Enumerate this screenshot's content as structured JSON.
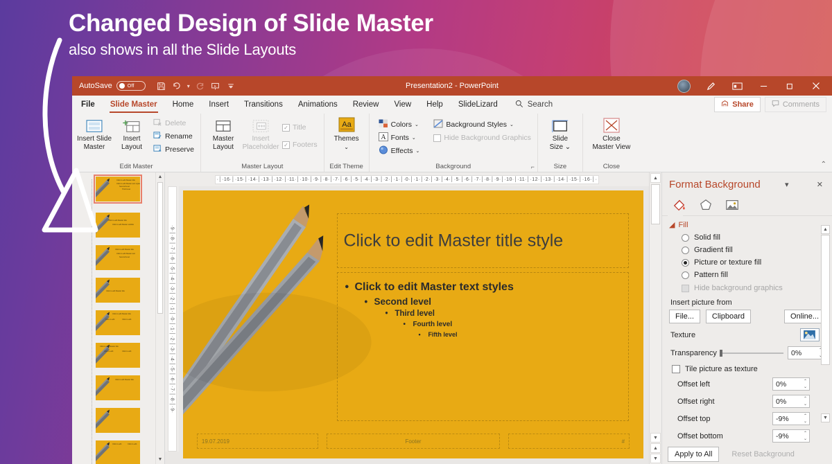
{
  "headline": {
    "title": "Changed Design of Slide Master",
    "subtitle": "also shows in all the Slide Layouts"
  },
  "colors": {
    "accent": "#b7472a",
    "slide_bg": "#e8aa14",
    "bg_gradient_start": "#5b3b9e",
    "bg_gradient_end": "#d04e45"
  },
  "titlebar": {
    "autosave_label": "AutoSave",
    "autosave_state": "Off",
    "document_title": "Presentation2  -  PowerPoint",
    "icons": [
      "save-icon",
      "undo-icon",
      "undo-caret-icon",
      "redo-icon",
      "present-icon",
      "customize-qat-icon"
    ],
    "window_buttons": [
      "minimize",
      "restore",
      "close"
    ]
  },
  "tabs": {
    "items": [
      {
        "label": "File",
        "active": false
      },
      {
        "label": "Slide Master",
        "active": true
      },
      {
        "label": "Home",
        "active": false
      },
      {
        "label": "Insert",
        "active": false
      },
      {
        "label": "Transitions",
        "active": false
      },
      {
        "label": "Animations",
        "active": false
      },
      {
        "label": "Review",
        "active": false
      },
      {
        "label": "View",
        "active": false
      },
      {
        "label": "Help",
        "active": false
      },
      {
        "label": "SlideLizard",
        "active": false
      }
    ],
    "search_placeholder": "Search",
    "share_label": "Share",
    "comments_label": "Comments"
  },
  "ribbon": {
    "groups": [
      {
        "name": "Edit Master",
        "big": [
          {
            "label_line1": "Insert Slide",
            "label_line2": "Master",
            "enabled": true
          },
          {
            "label_line1": "Insert",
            "label_line2": "Layout",
            "enabled": true
          }
        ],
        "small": [
          {
            "label": "Delete",
            "enabled": false
          },
          {
            "label": "Rename",
            "enabled": true
          },
          {
            "label": "Preserve",
            "enabled": true
          }
        ]
      },
      {
        "name": "Master Layout",
        "big": [
          {
            "label_line1": "Master",
            "label_line2": "Layout",
            "enabled": true
          },
          {
            "label_line1": "Insert",
            "label_line2": "Placeholder",
            "enabled": false
          }
        ],
        "small": [
          {
            "label": "Title",
            "enabled": false,
            "checked": true
          },
          {
            "label": "Footers",
            "enabled": false,
            "checked": true
          }
        ]
      },
      {
        "name": "Edit Theme",
        "big": [
          {
            "label_line1": "Themes",
            "label_line2": "",
            "enabled": true
          }
        ],
        "small": []
      },
      {
        "name": "Background",
        "big": [],
        "small": [
          {
            "label": "Colors",
            "enabled": true
          },
          {
            "label": "Fonts",
            "enabled": true
          },
          {
            "label": "Effects",
            "enabled": true
          },
          {
            "label": "Background Styles",
            "enabled": true
          },
          {
            "label": "Hide Background Graphics",
            "enabled": false
          }
        ]
      },
      {
        "name": "Size",
        "big": [
          {
            "label_line1": "Slide",
            "label_line2": "Size",
            "enabled": true
          }
        ],
        "small": []
      },
      {
        "name": "Close",
        "big": [
          {
            "label_line1": "Close",
            "label_line2": "Master View",
            "enabled": true
          }
        ],
        "small": []
      }
    ]
  },
  "thumbnails": {
    "selected_number": "1",
    "count": 9
  },
  "rulers": {
    "horizontal": "·│·16·│·15·│·14·│·13·│·12·│·11·│·10·│·9·│·8·│·7·│·6·│·5·│·4·│·3·│·2·│·1·│·0·│·1·│·2·│·3·│·4·│·5·│·6·│·7·│·8·│·9·│·10·│·11·│·12·│·13·│·14·│·15·│·16·│·",
    "vertical": "·9·│·8·│·7·│·6·│·5·│·4·│·3·│·2·│·1·│·0·│·1·│·2·│·3·│·4·│·5·│·6·│·7·│·8·│·9·"
  },
  "slide": {
    "title_placeholder": "Click to edit Master title style",
    "body_levels": [
      "Click to edit Master text styles",
      "Second level",
      "Third level",
      "Fourth level",
      "Fifth level"
    ],
    "footer_date": "19.07.2019",
    "footer_text": "Footer",
    "footer_slide_number": "#"
  },
  "format_background": {
    "title": "Format Background",
    "tabs": [
      "fill-icon",
      "effects-icon",
      "picture-icon"
    ],
    "section_fill": "Fill",
    "fill_options": [
      {
        "label": "Solid fill",
        "selected": false
      },
      {
        "label": "Gradient fill",
        "selected": false
      },
      {
        "label": "Picture or texture fill",
        "selected": true
      },
      {
        "label": "Pattern fill",
        "selected": false
      }
    ],
    "hide_background_graphics": "Hide background graphics",
    "insert_picture_from": "Insert picture from",
    "insert_buttons": [
      "File...",
      "Clipboard",
      "Online..."
    ],
    "texture_label": "Texture",
    "transparency_label": "Transparency",
    "transparency_value": "0%",
    "tile_label": "Tile picture as texture",
    "offsets": [
      {
        "label": "Offset left",
        "value": "0%"
      },
      {
        "label": "Offset right",
        "value": "0%"
      },
      {
        "label": "Offset top",
        "value": "-9%"
      },
      {
        "label": "Offset bottom",
        "value": "-9%"
      }
    ],
    "apply_to_all": "Apply to All",
    "reset_background": "Reset Background"
  }
}
